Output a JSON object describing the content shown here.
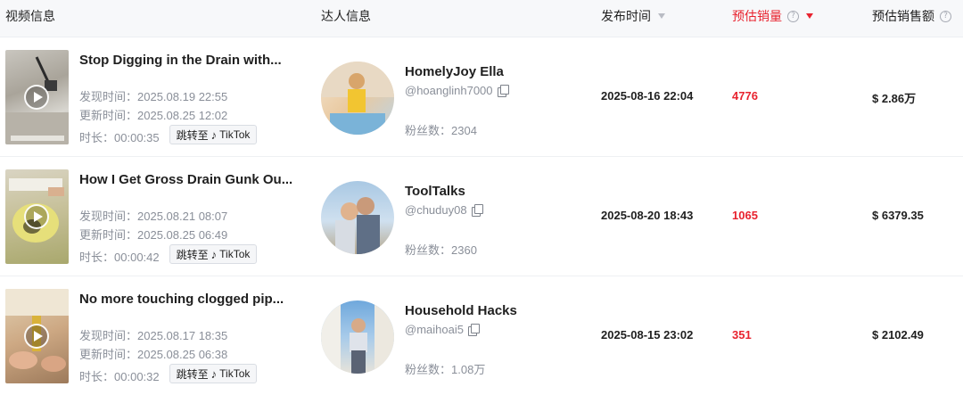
{
  "headers": {
    "video_info": "视频信息",
    "creator_info": "达人信息",
    "publish_time": "发布时间",
    "est_sales": "预估销量",
    "est_revenue": "预估销售额"
  },
  "labels": {
    "found": "发现时间：",
    "updated": "更新时间：",
    "duration": "时长：",
    "jump": "跳转至",
    "tiktok": "TikTok",
    "fans": "粉丝数："
  },
  "colors": {
    "accent": "#e8232f"
  },
  "rows": [
    {
      "title": "Stop Digging in the Drain with...",
      "found_time": "2025.08.19 22:55",
      "updated_time": "2025.08.25 12:02",
      "duration": "00:00:35",
      "creator_name": "HomelyJoy Ella",
      "creator_handle": "@hoanglinh7000",
      "fans": "2304",
      "publish_time": "2025-08-16 22:04",
      "sales": "4776",
      "revenue": "$ 2.86万"
    },
    {
      "title": "How I Get Gross Drain Gunk Ou...",
      "found_time": "2025.08.21 08:07",
      "updated_time": "2025.08.25 06:49",
      "duration": "00:00:42",
      "creator_name": "ToolTalks",
      "creator_handle": "@chuduy08",
      "fans": "2360",
      "publish_time": "2025-08-20 18:43",
      "sales": "1065",
      "revenue": "$ 6379.35"
    },
    {
      "title": "No more touching clogged pip...",
      "found_time": "2025.08.17 18:35",
      "updated_time": "2025.08.25 06:38",
      "duration": "00:00:32",
      "creator_name": "Household Hacks",
      "creator_handle": "@maihoai5",
      "fans": "1.08万",
      "publish_time": "2025-08-15 23:02",
      "sales": "351",
      "revenue": "$ 2102.49"
    }
  ]
}
